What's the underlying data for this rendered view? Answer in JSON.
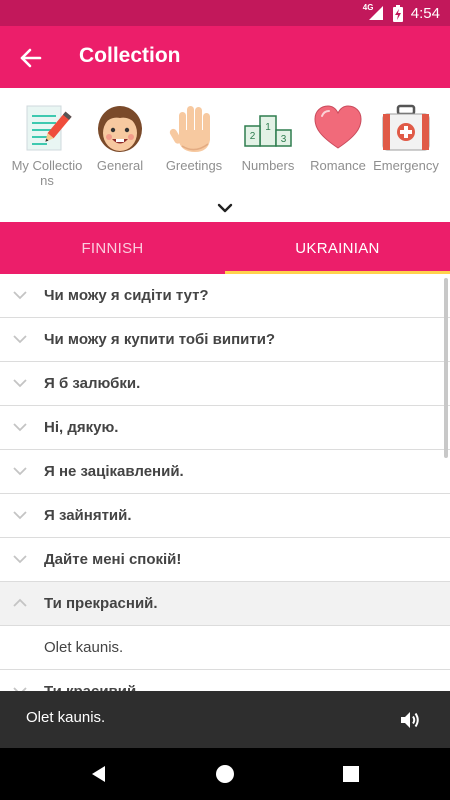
{
  "status_bar": {
    "network": "4G",
    "time": "4:54"
  },
  "app_bar": {
    "title": "Collection"
  },
  "categories": [
    {
      "label": "My Collections",
      "icon": "notepad-pencil-icon"
    },
    {
      "label": "General",
      "icon": "smiling-face-icon"
    },
    {
      "label": "Greetings",
      "icon": "waving-hand-icon"
    },
    {
      "label": "Numbers",
      "icon": "podium-icon"
    },
    {
      "label": "Romance",
      "icon": "heart-icon"
    },
    {
      "label": "Emergency",
      "icon": "first-aid-kit-icon"
    }
  ],
  "tabs": [
    {
      "label": "FINNISH",
      "active": false
    },
    {
      "label": "UKRAINIAN",
      "active": true
    }
  ],
  "phrases": [
    {
      "text": "Чи можу я сидіти тут?"
    },
    {
      "text": "Чи можу я купити тобі випити?"
    },
    {
      "text": "Я б залюбки."
    },
    {
      "text": "Ні, дякую."
    },
    {
      "text": "Я не зацікавлений."
    },
    {
      "text": "Я зайнятий."
    },
    {
      "text": "Дайте мені спокій!"
    },
    {
      "text": "Ти прекрасний.",
      "expanded": true
    },
    {
      "text": "Olet kaunis.",
      "answer": true
    },
    {
      "text": "Ти красивий."
    }
  ],
  "snackbar": {
    "text": "Olet kaunis."
  },
  "colors": {
    "primary": "#ec1e6a",
    "status": "#c2185b",
    "indicator": "#ffd24d"
  }
}
